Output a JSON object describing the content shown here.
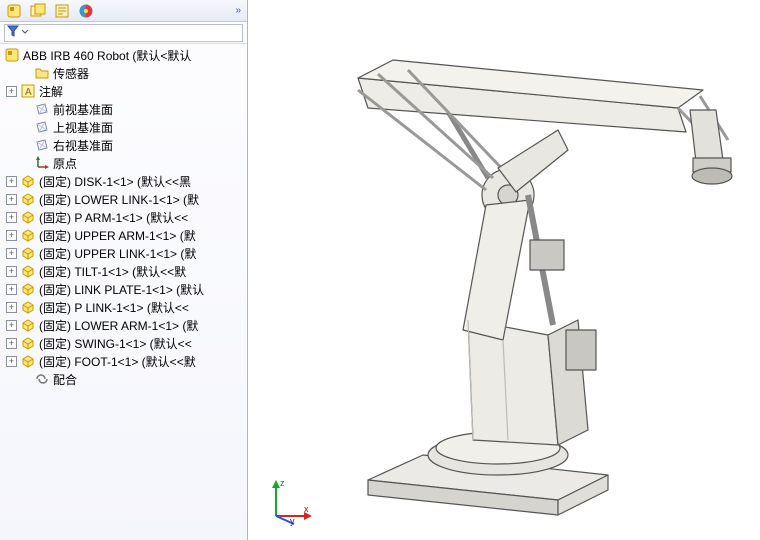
{
  "toolbar": {
    "chevrons": "»"
  },
  "filter": {
    "icon_name": "filter-icon"
  },
  "root": {
    "label": "ABB IRB 460 Robot  (默认<默认"
  },
  "nodes": [
    {
      "icon": "folder",
      "exp": "none",
      "label": "传感器",
      "indent": 1
    },
    {
      "icon": "annote",
      "exp": "+",
      "label": "注解",
      "indent": 0
    },
    {
      "icon": "plane",
      "exp": "none",
      "label": "前视基准面",
      "indent": 1
    },
    {
      "icon": "plane",
      "exp": "none",
      "label": "上视基准面",
      "indent": 1
    },
    {
      "icon": "plane",
      "exp": "none",
      "label": "右视基准面",
      "indent": 1
    },
    {
      "icon": "origin",
      "exp": "none",
      "label": "原点",
      "indent": 1
    },
    {
      "icon": "part",
      "exp": "+",
      "label": "(固定) DISK-1<1> (默认<<黑",
      "indent": 0
    },
    {
      "icon": "part",
      "exp": "+",
      "label": "(固定) LOWER LINK-1<1> (默",
      "indent": 0
    },
    {
      "icon": "part",
      "exp": "+",
      "label": "(固定) P ARM-1<1> (默认<<",
      "indent": 0
    },
    {
      "icon": "part",
      "exp": "+",
      "label": "(固定) UPPER ARM-1<1> (默",
      "indent": 0
    },
    {
      "icon": "part",
      "exp": "+",
      "label": "(固定) UPPER LINK-1<1> (默",
      "indent": 0
    },
    {
      "icon": "part",
      "exp": "+",
      "label": "(固定) TILT-1<1> (默认<<默",
      "indent": 0
    },
    {
      "icon": "part",
      "exp": "+",
      "label": "(固定) LINK PLATE-1<1> (默认",
      "indent": 0
    },
    {
      "icon": "part",
      "exp": "+",
      "label": "(固定) P LINK-1<1> (默认<<",
      "indent": 0
    },
    {
      "icon": "part",
      "exp": "+",
      "label": "(固定) LOWER ARM-1<1> (默",
      "indent": 0
    },
    {
      "icon": "part",
      "exp": "+",
      "label": "(固定) SWING-1<1> (默认<<",
      "indent": 0
    },
    {
      "icon": "part",
      "exp": "+",
      "label": "(固定) FOOT-1<1> (默认<<默",
      "indent": 0
    },
    {
      "icon": "mate",
      "exp": "none",
      "label": "配合",
      "indent": 1
    }
  ],
  "triad": {
    "x": "x",
    "y": "y",
    "z": "z"
  }
}
